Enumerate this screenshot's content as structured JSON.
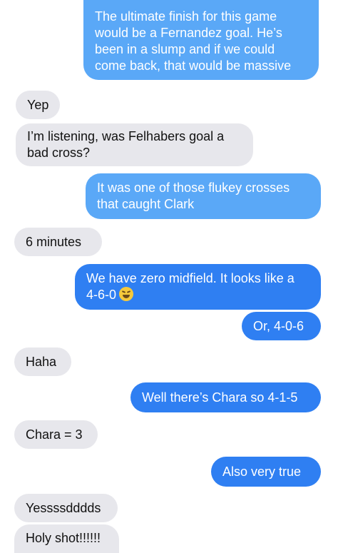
{
  "messages": [
    {
      "from": "me",
      "text": "The ultimate finish for this game\nwould be a Fernandez goal. He’s\nbeen in a slump and if we could\ncome back, that would be massive"
    },
    {
      "from": "them",
      "text": "Yep"
    },
    {
      "from": "them",
      "text": "I’m listening, was Felhabers goal a\nbad cross?"
    },
    {
      "from": "me",
      "text": "It was one of those flukey crosses\nthat caught Clark"
    },
    {
      "from": "them",
      "text": "6 minutes"
    },
    {
      "from": "me",
      "text": "We have zero midfield. It looks like a\n4-6-0",
      "emoji": "laughing-emoji"
    },
    {
      "from": "me",
      "text": "Or, 4-0-6"
    },
    {
      "from": "them",
      "text": "Haha"
    },
    {
      "from": "me",
      "text": "Well there’s Chara so 4-1-5"
    },
    {
      "from": "them",
      "text": "Chara = 3"
    },
    {
      "from": "me",
      "text": "Also very true"
    },
    {
      "from": "them",
      "text": "Yessssdddds"
    },
    {
      "from": "them",
      "text": "Holy shot!!!!!!"
    }
  ],
  "colors": {
    "sent": "#2f7ff2",
    "sent_light": "#5aa8f7",
    "received": "#e7e7ec",
    "background": "#ffffff"
  }
}
